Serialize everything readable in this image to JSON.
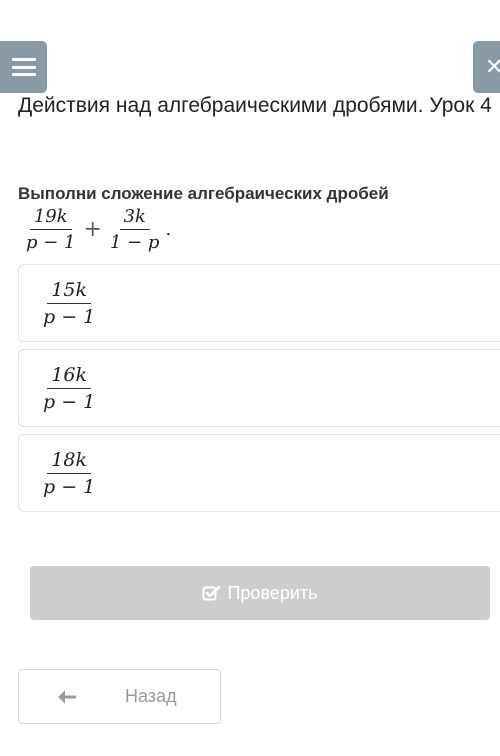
{
  "header": {
    "menu_icon": "hamburger-menu-icon",
    "close_icon": "close-icon",
    "close_glyph": "✕",
    "title": "Действия над алгебраическими дробями. Урок 4"
  },
  "task": {
    "prompt": "Выполни сложение алгебраических дробей",
    "expression": {
      "left": {
        "num": "19k",
        "den": "p − 1"
      },
      "operator": "+",
      "right": {
        "num": "3k",
        "den": "1 − p"
      },
      "end": "."
    }
  },
  "options": [
    {
      "num": "15k",
      "den": "p − 1"
    },
    {
      "num": "16k",
      "den": "p − 1"
    },
    {
      "num": "18k",
      "den": "p − 1"
    }
  ],
  "actions": {
    "check_label": "Проверить",
    "check_icon": "checkbox-check-icon",
    "back_label": "Назад",
    "back_icon": "arrow-left-icon"
  },
  "colors": {
    "header_button": "#8a9aa5",
    "check_button_disabled": "#cdcdcd",
    "option_border": "#e2e2e2"
  }
}
